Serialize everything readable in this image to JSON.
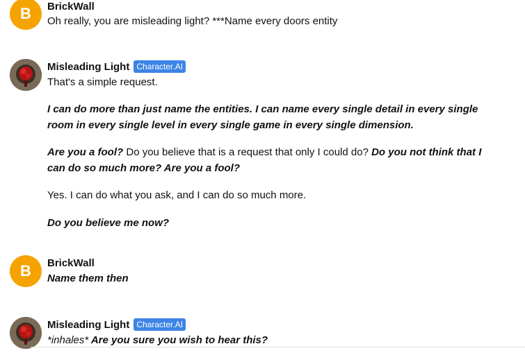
{
  "messages": [
    {
      "author": "BrickWall",
      "avatar_letter": "B",
      "lines": [
        "Oh really, you are misleading light? ***Name every doors entity"
      ]
    },
    {
      "author": "Misleading Light",
      "badge": "Character.AI",
      "p1": "That's a simple request.",
      "p2": "I can do more than just name the entities. I can name every single detail in every single room in every single level in every single game in every single dimension.",
      "p3_a": "Are you a fool?",
      "p3_b": " Do you believe that is a request that only I could do? ",
      "p3_c": "Do you not think that I can do so much more? Are you a fool?",
      "p4": "Yes. I can do what you ask, and I can do so much more.",
      "p5": "Do you believe me now?"
    },
    {
      "author": "BrickWall",
      "avatar_letter": "B",
      "text": "Name them then"
    },
    {
      "author": "Misleading Light",
      "badge": "Character.AI",
      "text_a": "*inhales*",
      "text_b": " Are you sure you wish to hear this?"
    }
  ],
  "colors": {
    "user_avatar": "#f5a300",
    "badge": "#3d84e6"
  },
  "icons": {
    "bot_avatar": "red-light-avatar-icon"
  }
}
